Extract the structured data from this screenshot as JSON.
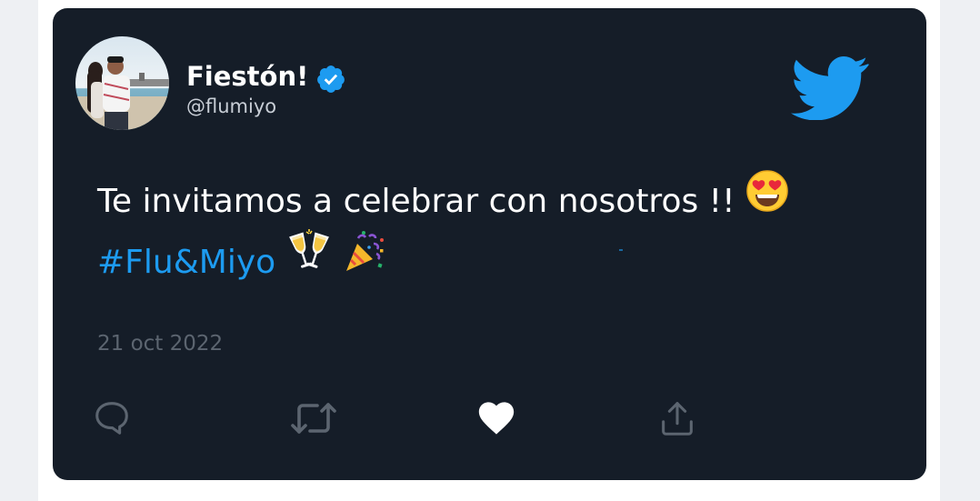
{
  "tweet": {
    "display_name": "Fiestón!",
    "handle": "@flumiyo",
    "text_line1": "Te invitamos a celebrar con nosotros !!",
    "hashtag": "#Flu&Miyo",
    "date": "21 oct 2022",
    "verified": true
  },
  "icons": {
    "verified": "verified-badge-icon",
    "brand": "twitter-bird-icon",
    "reply": "reply-icon",
    "retweet": "retweet-icon",
    "like": "heart-icon",
    "share": "share-icon"
  },
  "emojis": {
    "line1": "smiling-face-with-heart-eyes",
    "line2": [
      "clinking-glasses",
      "party-popper"
    ]
  },
  "colors": {
    "card_background": "#151d28",
    "accent": "#1d9bf0",
    "text": "#ffffff",
    "muted": "#5c6570",
    "page_background": "#ffffff"
  }
}
